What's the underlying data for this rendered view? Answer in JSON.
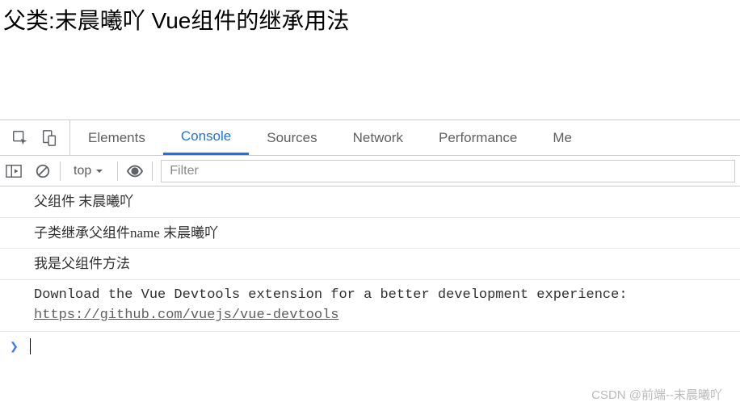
{
  "page": {
    "title": "父类:末晨曦吖 Vue组件的继承用法"
  },
  "devtools": {
    "tabs": {
      "elements": "Elements",
      "console": "Console",
      "sources": "Sources",
      "network": "Network",
      "performance": "Performance",
      "memory_partial": "Me"
    },
    "toolbar": {
      "context": "top",
      "filter_placeholder": "Filter"
    },
    "console": {
      "rows": [
        "父组件 末晨曦吖",
        "子类继承父组件name 末晨曦吖",
        "我是父组件方法"
      ],
      "devtools_msg": "Download the Vue Devtools extension for a better development experience:",
      "devtools_link": "https://github.com/vuejs/vue-devtools"
    }
  },
  "watermark": "CSDN @前端--末晨曦吖"
}
